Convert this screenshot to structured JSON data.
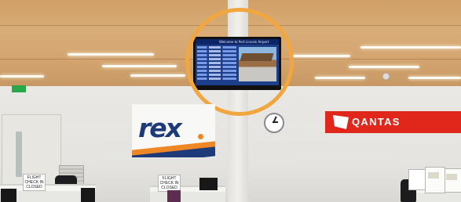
{
  "scene": {
    "airline_left_logo": "rex",
    "airline_right_logo": "QANTAS",
    "tv_header": "Welcome to Port Lincoln Airport",
    "counter_signs": [
      [
        "FLIGHT",
        "CHECK IN",
        "CLOSED"
      ],
      [
        "FLIGHT",
        "CHECK IN",
        "CLOSED"
      ]
    ],
    "highlight_color": "#f2a640",
    "rex_blue": "#1f3a78",
    "rex_orange": "#f08726",
    "qantas_red": "#e1261c"
  }
}
